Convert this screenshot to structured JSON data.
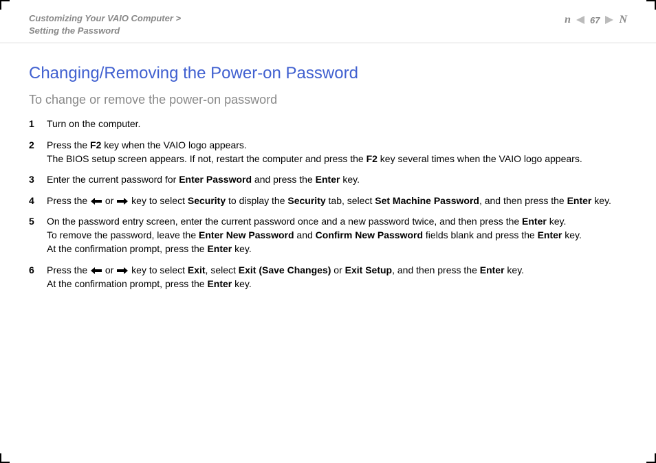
{
  "breadcrumb": {
    "line1": "Customizing Your VAIO Computer >",
    "line2": "Setting the Password"
  },
  "pageNav": {
    "pageNumber": "67",
    "navLetterLeft": "n",
    "navLetterRight": "N"
  },
  "title": "Changing/Removing the Power-on Password",
  "subtitle": "To change or remove the power-on password",
  "steps": [
    {
      "num": "1",
      "segments": [
        {
          "t": "text",
          "v": "Turn on the computer."
        }
      ]
    },
    {
      "num": "2",
      "segments": [
        {
          "t": "text",
          "v": "Press the "
        },
        {
          "t": "bold",
          "v": "F2"
        },
        {
          "t": "text",
          "v": " key when the VAIO logo appears."
        },
        {
          "t": "br"
        },
        {
          "t": "text",
          "v": "The BIOS setup screen appears. If not, restart the computer and press the "
        },
        {
          "t": "bold",
          "v": "F2"
        },
        {
          "t": "text",
          "v": " key several times when the VAIO logo appears."
        }
      ]
    },
    {
      "num": "3",
      "segments": [
        {
          "t": "text",
          "v": "Enter the current password for "
        },
        {
          "t": "bold",
          "v": "Enter Password"
        },
        {
          "t": "text",
          "v": " and press the "
        },
        {
          "t": "bold",
          "v": "Enter"
        },
        {
          "t": "text",
          "v": " key."
        }
      ]
    },
    {
      "num": "4",
      "segments": [
        {
          "t": "text",
          "v": "Press the "
        },
        {
          "t": "arrow-left"
        },
        {
          "t": "text",
          "v": " or "
        },
        {
          "t": "arrow-right"
        },
        {
          "t": "text",
          "v": " key to select "
        },
        {
          "t": "bold",
          "v": "Security"
        },
        {
          "t": "text",
          "v": " to display the "
        },
        {
          "t": "bold",
          "v": "Security"
        },
        {
          "t": "text",
          "v": " tab, select "
        },
        {
          "t": "bold",
          "v": "Set Machine Password"
        },
        {
          "t": "text",
          "v": ", and then press the "
        },
        {
          "t": "bold",
          "v": "Enter"
        },
        {
          "t": "text",
          "v": " key."
        }
      ]
    },
    {
      "num": "5",
      "segments": [
        {
          "t": "text",
          "v": "On the password entry screen, enter the current password once and a new password twice, and then press the "
        },
        {
          "t": "bold",
          "v": "Enter"
        },
        {
          "t": "text",
          "v": " key."
        },
        {
          "t": "br"
        },
        {
          "t": "text",
          "v": "To remove the password, leave the "
        },
        {
          "t": "bold",
          "v": "Enter New Password"
        },
        {
          "t": "text",
          "v": " and "
        },
        {
          "t": "bold",
          "v": "Confirm New Password"
        },
        {
          "t": "text",
          "v": " fields blank and press the "
        },
        {
          "t": "bold",
          "v": "Enter"
        },
        {
          "t": "text",
          "v": " key."
        },
        {
          "t": "br"
        },
        {
          "t": "text",
          "v": "At the confirmation prompt, press the "
        },
        {
          "t": "bold",
          "v": "Enter"
        },
        {
          "t": "text",
          "v": " key."
        }
      ]
    },
    {
      "num": "6",
      "segments": [
        {
          "t": "text",
          "v": "Press the "
        },
        {
          "t": "arrow-left"
        },
        {
          "t": "text",
          "v": " or "
        },
        {
          "t": "arrow-right"
        },
        {
          "t": "text",
          "v": " key to select "
        },
        {
          "t": "bold",
          "v": "Exit"
        },
        {
          "t": "text",
          "v": ", select "
        },
        {
          "t": "bold",
          "v": "Exit (Save Changes)"
        },
        {
          "t": "text",
          "v": " or "
        },
        {
          "t": "bold",
          "v": "Exit Setup"
        },
        {
          "t": "text",
          "v": ", and then press the "
        },
        {
          "t": "bold",
          "v": "Enter"
        },
        {
          "t": "text",
          "v": " key."
        },
        {
          "t": "br"
        },
        {
          "t": "text",
          "v": "At the confirmation prompt, press the "
        },
        {
          "t": "bold",
          "v": "Enter"
        },
        {
          "t": "text",
          "v": " key."
        }
      ]
    }
  ]
}
